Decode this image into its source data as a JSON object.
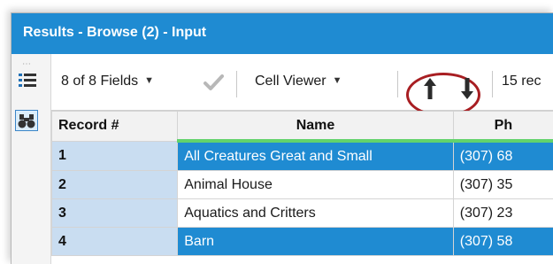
{
  "window": {
    "title": "Results - Browse (2) - Input"
  },
  "sidebar": {
    "grip_text": "⋯",
    "icons": [
      "list-icon",
      "binoculars-icon"
    ]
  },
  "toolbar": {
    "fields_label": "8 of 8 Fields",
    "viewer_label": "Cell Viewer",
    "records_label": "15 rec",
    "icons": [
      "chevron-down-icon",
      "checkmark-icon",
      "arrow-up-icon",
      "arrow-down-icon"
    ],
    "highlight_color": "#a81e22"
  },
  "table": {
    "columns": [
      "Record #",
      "Name",
      "Ph"
    ],
    "rows": [
      {
        "record": "1",
        "name": "All Creatures Great and Small",
        "phone": "(307) 68",
        "selected": true
      },
      {
        "record": "2",
        "name": "Animal House",
        "phone": "(307) 35",
        "selected": false
      },
      {
        "record": "3",
        "name": "Aquatics and Critters",
        "phone": "(307) 23",
        "selected": false
      },
      {
        "record": "4",
        "name": "Barn",
        "phone": "(307) 58",
        "selected": true
      }
    ]
  },
  "colors": {
    "accent": "#1f8bd2",
    "record_cell": "#c9ddf1",
    "column_marker": "#62d36c",
    "checkmark": "#b8b8b8"
  }
}
